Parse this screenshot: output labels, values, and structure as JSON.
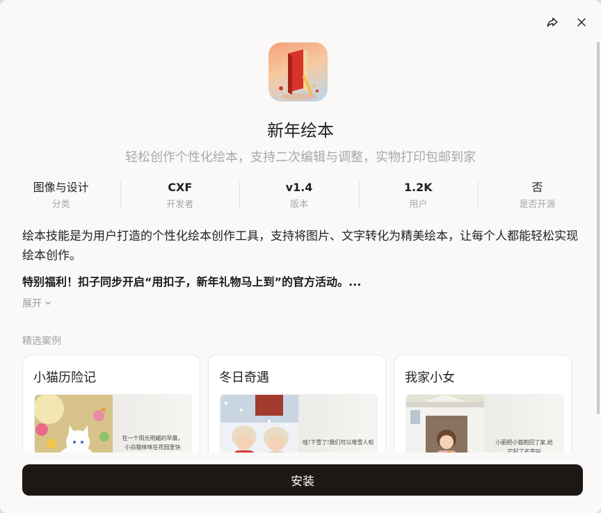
{
  "app": {
    "title": "新年绘本",
    "subtitle": "轻松创作个性化绘本，支持二次编辑与调整，实物打印包邮到家"
  },
  "stats": [
    {
      "value": "图像与设计",
      "label": "分类"
    },
    {
      "value": "CXF",
      "label": "开发者"
    },
    {
      "value": "v1.4",
      "label": "版本"
    },
    {
      "value": "1.2K",
      "label": "用户"
    },
    {
      "value": "否",
      "label": "是否开源"
    }
  ],
  "description": "绘本技能是为用户打造的个性化绘本创作工具，支持将图片、文字转化为精美绘本，让每个人都能轻松实现绘本创作。",
  "promo": "特别福利！扣子同步开启“用扣子，新年礼物马上到”的官方活动。...",
  "expand_label": "展开",
  "section_title": "精选案例",
  "cases": [
    {
      "title": "小猫历险记",
      "lines": [
        "在一个阳光明媚的早晨，",
        "小白猫咪咪在花园里快"
      ]
    },
    {
      "title": "冬日奇遇",
      "lines": [
        "哇!下雪了!我们可以堆雪人啦!"
      ]
    },
    {
      "title": "我家小女",
      "lines": [
        "小丽把小猫抱回了家,给",
        "它起了名字叫"
      ]
    }
  ],
  "install_label": "安装",
  "colors": {
    "install_button": "#1b1816",
    "background": "#faf9f7",
    "muted_text": "#a8a8a8"
  }
}
